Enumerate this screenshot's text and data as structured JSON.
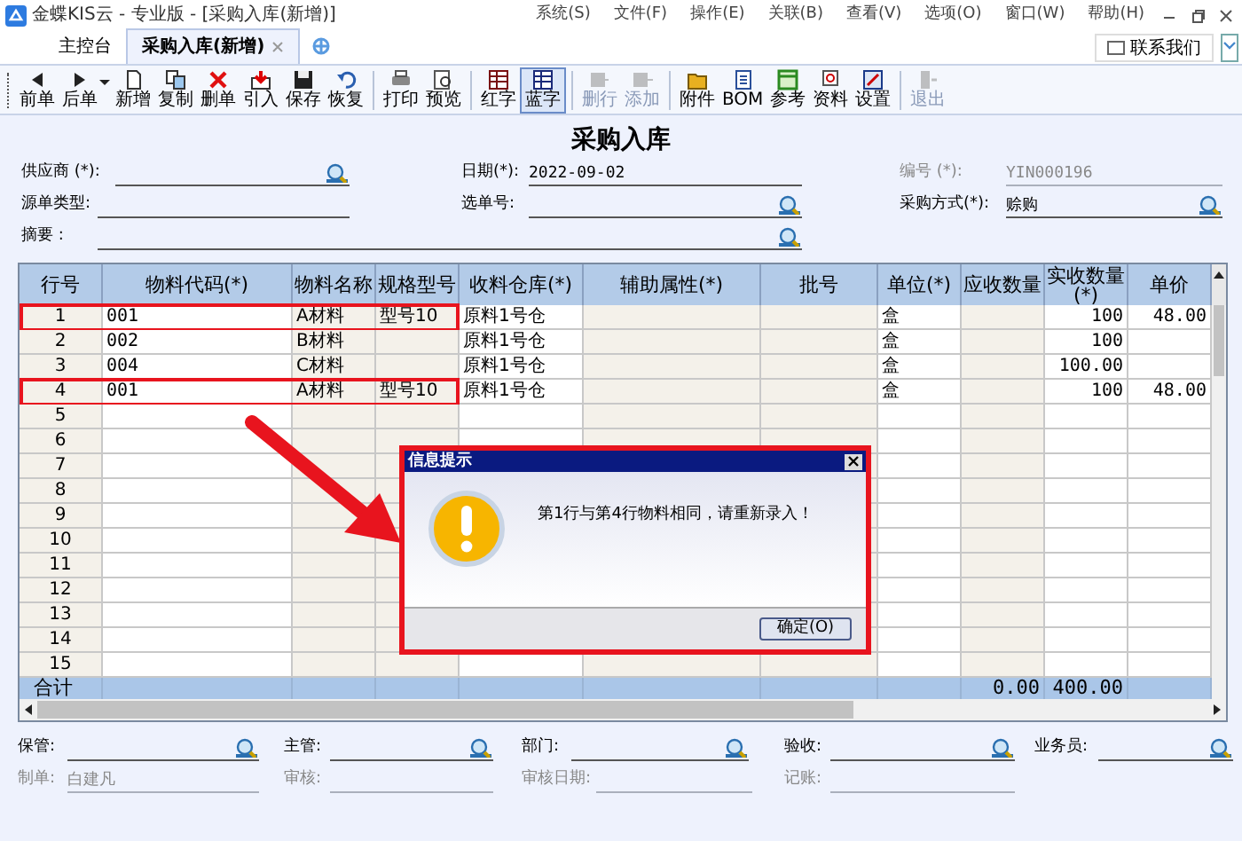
{
  "window": {
    "title": "金蝶KIS云 - 专业版 - [采购入库(新增)]"
  },
  "menu": [
    "系统(S)",
    "文件(F)",
    "操作(E)",
    "关联(B)",
    "查看(V)",
    "选项(O)",
    "窗口(W)",
    "帮助(H)"
  ],
  "tabs": [
    {
      "label": "主控台",
      "selected": false,
      "closable": false
    },
    {
      "label": "采购入库(新增)",
      "selected": true,
      "closable": true
    }
  ],
  "contact_button": "联系我们",
  "toolbar": {
    "groups": [
      [
        {
          "label": "前单",
          "disabled": false,
          "dropdown": false
        },
        {
          "label": "后单",
          "disabled": false,
          "dropdown": true
        },
        {
          "label": "新增",
          "disabled": false,
          "dropdown": false
        },
        {
          "label": "复制",
          "disabled": false,
          "dropdown": false
        },
        {
          "label": "删单",
          "disabled": false,
          "dropdown": false
        },
        {
          "label": "引入",
          "disabled": false,
          "dropdown": false
        },
        {
          "label": "保存",
          "disabled": false,
          "dropdown": false
        },
        {
          "label": "恢复",
          "disabled": false,
          "dropdown": false
        }
      ],
      [
        {
          "label": "打印",
          "disabled": false,
          "dropdown": false
        },
        {
          "label": "预览",
          "disabled": false,
          "dropdown": false
        }
      ],
      [
        {
          "label": "红字",
          "disabled": false,
          "dropdown": false,
          "selected": false
        },
        {
          "label": "蓝字",
          "disabled": false,
          "dropdown": false,
          "selected": true
        }
      ],
      [
        {
          "label": "删行",
          "disabled": true,
          "dropdown": false
        },
        {
          "label": "添加",
          "disabled": true,
          "dropdown": false
        }
      ],
      [
        {
          "label": "附件",
          "disabled": false,
          "dropdown": false
        },
        {
          "label": "BOM",
          "disabled": false,
          "dropdown": false
        },
        {
          "label": "参考",
          "disabled": false,
          "dropdown": false
        },
        {
          "label": "资料",
          "disabled": false,
          "dropdown": false
        },
        {
          "label": "设置",
          "disabled": false,
          "dropdown": false
        }
      ],
      [
        {
          "label": "退出",
          "disabled": true,
          "dropdown": false
        }
      ]
    ]
  },
  "form": {
    "title": "采购入库",
    "rows": [
      [
        {
          "label": "供应商 (*):",
          "lookup": true,
          "disabled": false
        },
        {
          "label": "日期(*):",
          "value": "2022-09-02",
          "lookup": false,
          "disabled": false
        },
        {
          "label": "编号 (*):",
          "value": "YIN000196",
          "lookup": false,
          "disabled": true
        }
      ],
      [
        {
          "label": "源单类型:",
          "lookup": false,
          "disabled": false
        },
        {
          "label": "选单号:",
          "lookup": true,
          "disabled": false
        },
        {
          "label": "采购方式(*):",
          "value": "赊购",
          "lookup": true,
          "disabled": false
        }
      ],
      [
        {
          "label": "摘要 :",
          "lookup": true,
          "disabled": false
        }
      ]
    ]
  },
  "table": {
    "columns": [
      "行号",
      "物料代码(*)",
      "物料名称",
      "规格型号",
      "收料仓库(*)",
      "辅助属性(*)",
      "批号",
      "单位(*)",
      "应收数量",
      "实收数量(*)",
      "单价"
    ],
    "rows": [
      {
        "highlighted": true,
        "cells": [
          "1",
          "001",
          "A材料",
          "型号10",
          "原料1号仓",
          "",
          "",
          "盒",
          "",
          "100",
          "48.00"
        ]
      },
      {
        "highlighted": false,
        "cells": [
          "2",
          "002",
          "B材料",
          "",
          "原料1号仓",
          "",
          "",
          "盒",
          "",
          "100",
          ""
        ]
      },
      {
        "highlighted": false,
        "cells": [
          "3",
          "004",
          "C材料",
          "",
          "原料1号仓",
          "",
          "",
          "盒",
          "",
          "100.00",
          ""
        ]
      },
      {
        "highlighted": true,
        "cells": [
          "4",
          "001",
          "A材料",
          "型号10",
          "原料1号仓",
          "",
          "",
          "盒",
          "",
          "100",
          "48.00"
        ]
      },
      {
        "highlighted": false,
        "cells": [
          "5"
        ]
      },
      {
        "highlighted": false,
        "cells": [
          "6"
        ]
      },
      {
        "highlighted": false,
        "cells": [
          "7"
        ]
      },
      {
        "highlighted": false,
        "cells": [
          "8"
        ]
      },
      {
        "highlighted": false,
        "cells": [
          "9"
        ]
      },
      {
        "highlighted": false,
        "cells": [
          "10"
        ]
      },
      {
        "highlighted": false,
        "cells": [
          "11"
        ]
      },
      {
        "highlighted": false,
        "cells": [
          "12"
        ]
      },
      {
        "highlighted": false,
        "cells": [
          "13"
        ]
      },
      {
        "highlighted": false,
        "cells": [
          "14"
        ]
      },
      {
        "highlighted": false,
        "cells": [
          "15"
        ]
      }
    ],
    "totals": {
      "label": "合计",
      "received_qty": "0.00",
      "actual_qty": "400.00"
    }
  },
  "footer": {
    "rows": [
      [
        {
          "label": "保管:",
          "lookup": true,
          "disabled": false
        },
        {
          "label": "主管:",
          "lookup": true,
          "disabled": false
        },
        {
          "label": "部门:",
          "lookup": true,
          "disabled": false
        },
        {
          "label": "验收:",
          "lookup": true,
          "disabled": false
        },
        {
          "label": "业务员:",
          "lookup": true,
          "disabled": false
        }
      ],
      [
        {
          "label": "制单:",
          "value": "白建凡",
          "lookup": false,
          "disabled": true
        },
        {
          "label": "审核:",
          "lookup": false,
          "disabled": true
        },
        {
          "label": "审核日期:",
          "lookup": false,
          "disabled": true
        },
        {
          "label": "记账:",
          "lookup": false,
          "disabled": true
        }
      ]
    ]
  },
  "dialog": {
    "title": "信息提示",
    "message": "第1行与第4行物料相同，请重新录入！",
    "button": "确定(O)"
  }
}
